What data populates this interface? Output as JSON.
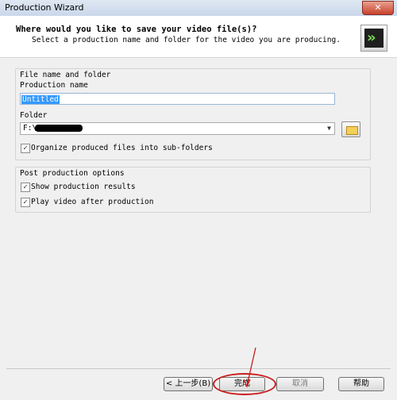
{
  "window": {
    "title": "Production Wizard",
    "close_glyph": "✕"
  },
  "header": {
    "heading": "Where would you like to save your video file(s)?",
    "subheading": "Select a production name and folder for the video you are producing."
  },
  "file_section": {
    "legend": "File name and folder",
    "production_name_label": "Production name",
    "production_name_value": "Untitled",
    "folder_label": "Folder",
    "folder_value": "F:\\",
    "organize_label": "Organize produced files into sub-folders",
    "organize_checked": true,
    "folder_icon": "folder-open-icon"
  },
  "post_section": {
    "legend": "Post production options",
    "show_results_label": "Show production results",
    "show_results_checked": true,
    "play_video_label": "Play video after production",
    "play_video_checked": true
  },
  "buttons": {
    "back": "< 上一步(B)",
    "finish": "完成",
    "cancel": "取消",
    "help": "帮助"
  },
  "check_glyph": "✓",
  "annotation_color": "#c81e1e"
}
